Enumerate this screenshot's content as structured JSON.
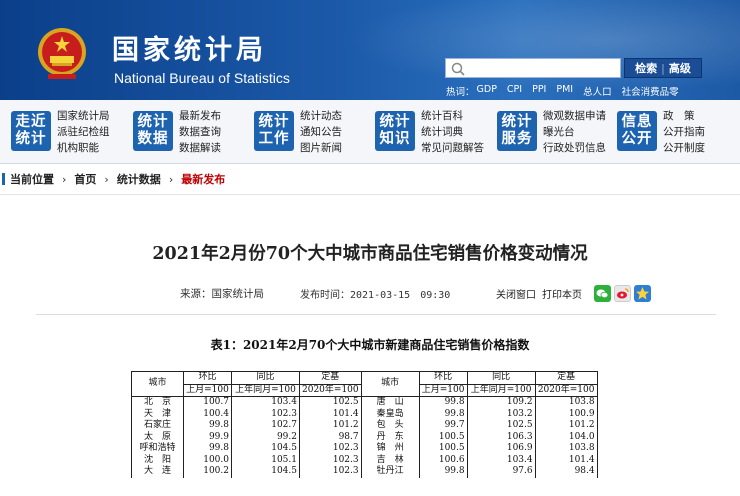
{
  "header": {
    "site_name_cn": "国家统计局",
    "site_name_en": "National Bureau of Statistics",
    "search_button": "检索",
    "advanced_button": "高级",
    "hot_label": "热词：",
    "hot_words": [
      "GDP",
      "CPI",
      "PPI",
      "PMI",
      "总人口",
      "社会消费品零"
    ],
    "colors": {
      "banner": "#1b59a8",
      "nav_icon": "#1e63b0"
    }
  },
  "nav": [
    {
      "icon": [
        "走近",
        "统计"
      ],
      "links": [
        "国家统计局",
        "派驻纪检组",
        "机构职能"
      ]
    },
    {
      "icon": [
        "统计",
        "数据"
      ],
      "links": [
        "最新发布",
        "数据查询",
        "数据解读"
      ]
    },
    {
      "icon": [
        "统计",
        "工作"
      ],
      "links": [
        "统计动态",
        "通知公告",
        "图片新闻"
      ]
    },
    {
      "icon": [
        "统计",
        "知识"
      ],
      "links": [
        "统计百科",
        "统计词典",
        "常见问题解答"
      ]
    },
    {
      "icon": [
        "统计",
        "服务"
      ],
      "links": [
        "微观数据申请",
        "曝光台",
        "行政处罚信息"
      ]
    },
    {
      "icon": [
        "信息",
        "公开"
      ],
      "links": [
        "政　策",
        "公开指南",
        "公开制度"
      ]
    }
  ],
  "breadcrumb": {
    "label": "当前位置",
    "items": [
      "首页",
      "统计数据",
      "最新发布"
    ]
  },
  "article": {
    "title": "2021年2月份70个大中城市商品住宅销售价格变动情况",
    "source": "来源：国家统计局",
    "published": "发布时间：2021-03-15　09:30",
    "close_window": "关闭窗口",
    "print": "打印本页",
    "share_icons": [
      "wechat-icon",
      "weibo-icon",
      "favorite-icon"
    ],
    "table_title": "表1：2021年2月70个大中城市新建商品住宅销售价格指数"
  },
  "table": {
    "headers": {
      "city": "城市",
      "mom": "环比",
      "yoy": "同比",
      "fixed": "定基",
      "mom_base": "上月=100",
      "yoy_base": "上年同月=100",
      "fixed_base": "2020年=100"
    },
    "rows": [
      [
        [
          "北　京",
          "100.7",
          "103.4",
          "102.5"
        ],
        [
          "唐　山",
          "99.8",
          "109.2",
          "103.8"
        ]
      ],
      [
        [
          "天　津",
          "100.4",
          "102.3",
          "101.4"
        ],
        [
          "秦皇岛",
          "99.8",
          "103.2",
          "100.9"
        ]
      ],
      [
        [
          "石家庄",
          "99.8",
          "102.7",
          "101.2"
        ],
        [
          "包　头",
          "99.7",
          "102.5",
          "101.2"
        ]
      ],
      [
        [
          "太　原",
          "99.9",
          "99.2",
          "98.7"
        ],
        [
          "丹　东",
          "100.5",
          "106.3",
          "104.0"
        ]
      ],
      [
        [
          "呼和浩特",
          "99.8",
          "104.5",
          "102.3"
        ],
        [
          "锦　州",
          "100.5",
          "106.9",
          "103.8"
        ]
      ],
      [
        [
          "沈　阳",
          "100.0",
          "105.1",
          "102.3"
        ],
        [
          "吉　林",
          "100.6",
          "103.4",
          "101.4"
        ]
      ],
      [
        [
          "大　连",
          "100.2",
          "104.5",
          "102.3"
        ],
        [
          "牡丹江",
          "99.8",
          "97.6",
          "98.4"
        ]
      ]
    ]
  }
}
